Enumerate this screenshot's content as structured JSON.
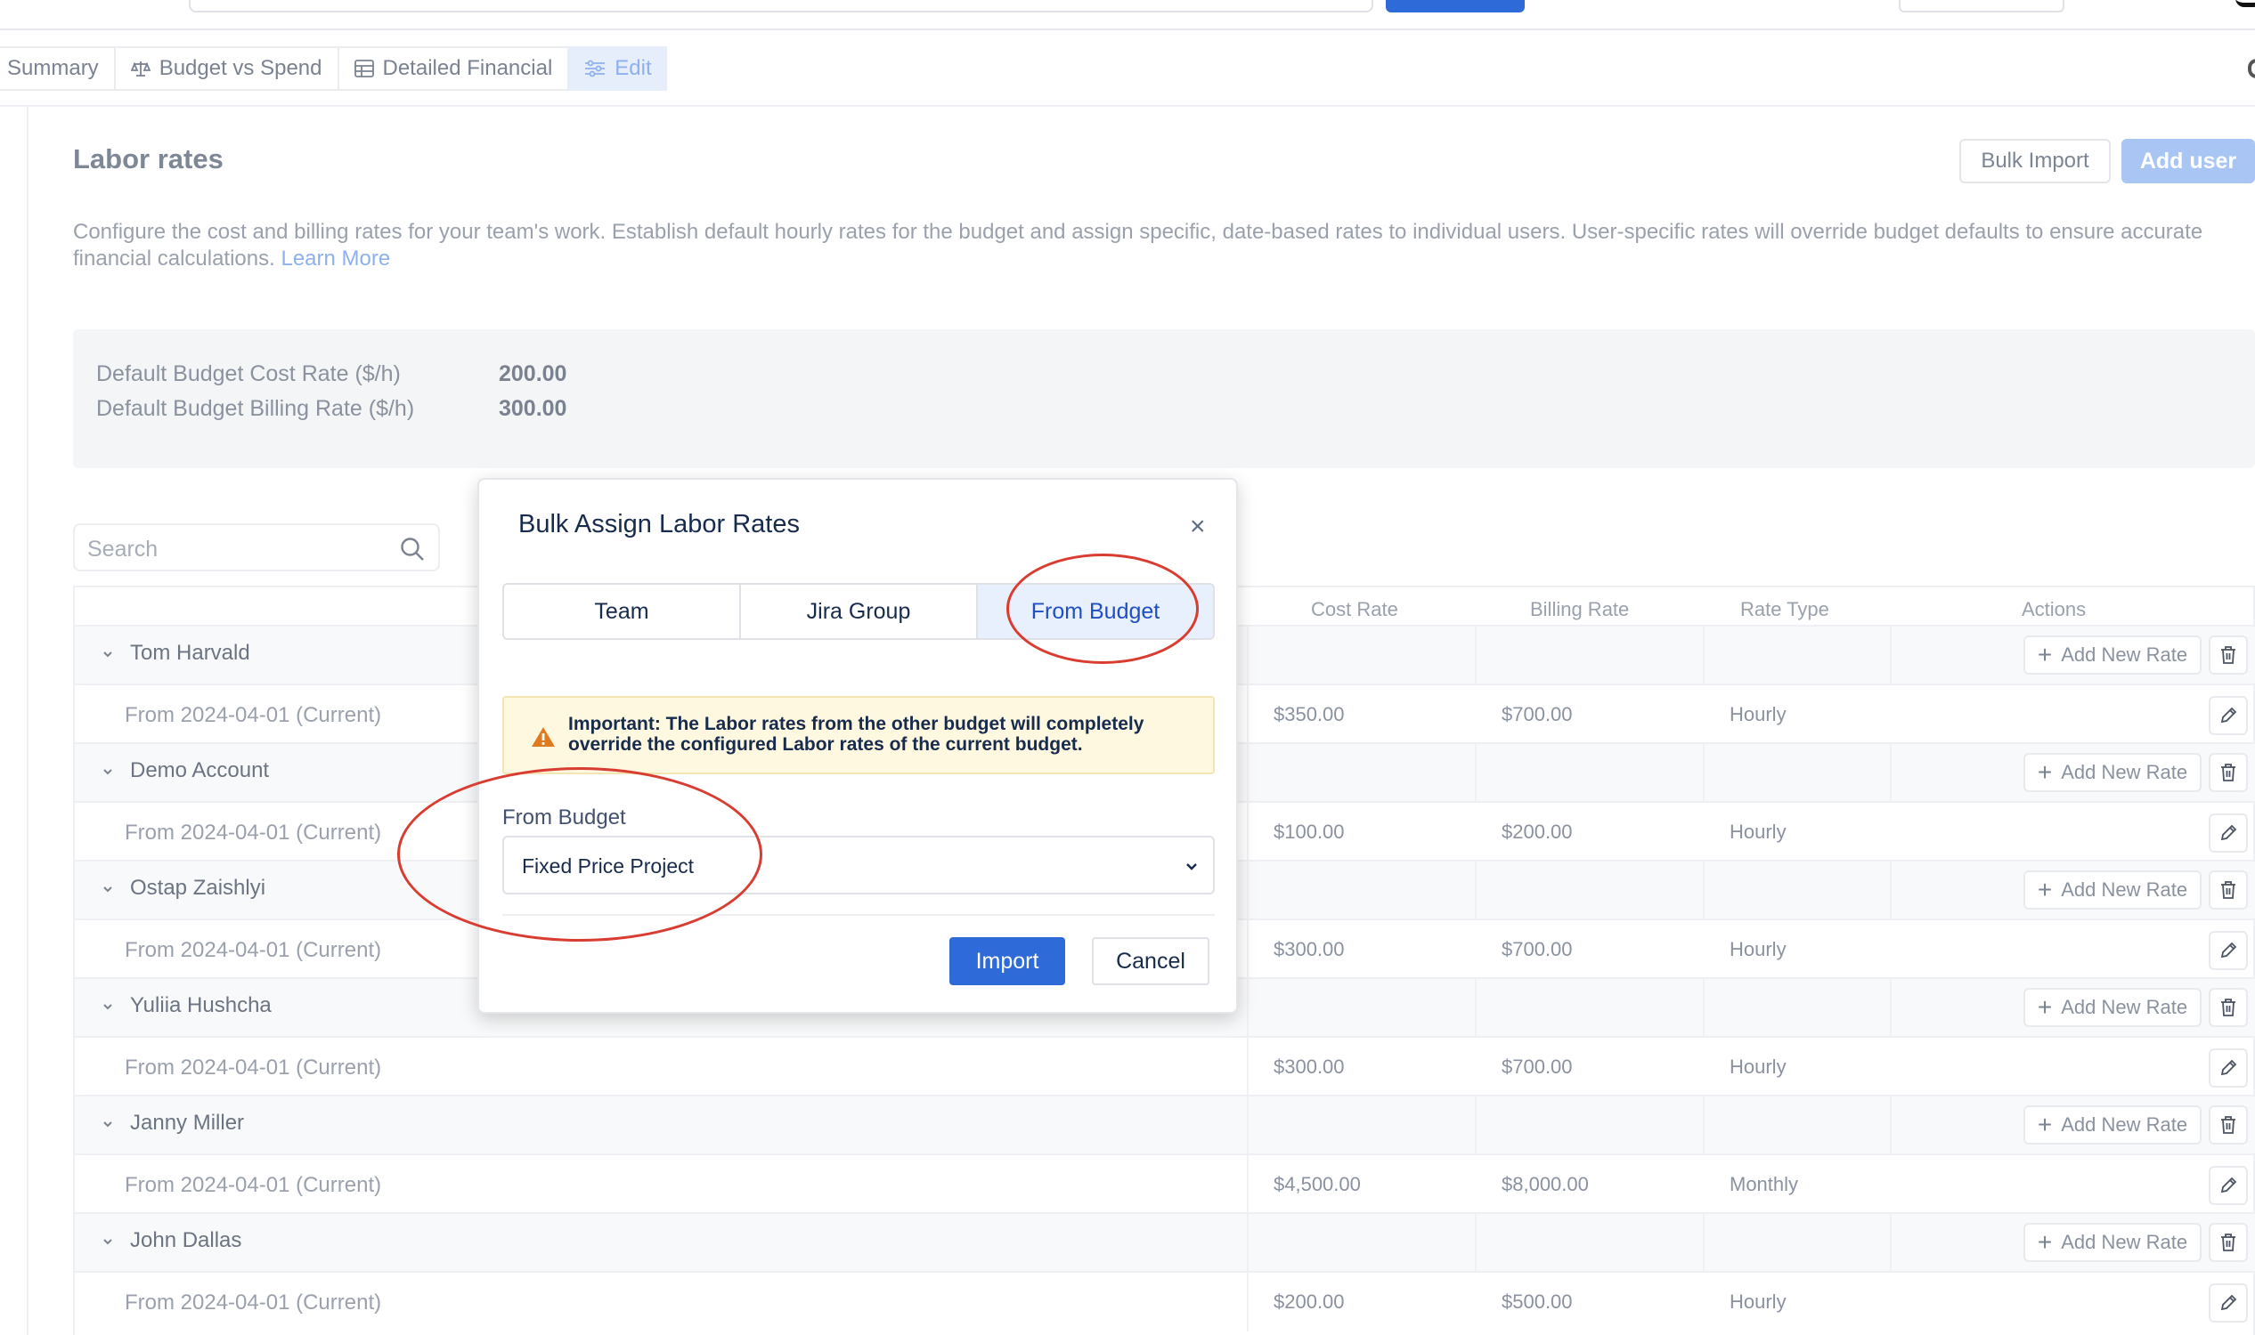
{
  "tabs": [
    {
      "label": "Summary",
      "icon": "none"
    },
    {
      "label": "Budget vs Spend",
      "icon": "scale-icon"
    },
    {
      "label": "Detailed Financial",
      "icon": "table-icon"
    },
    {
      "label": "Edit",
      "icon": "sliders-icon",
      "active": true
    }
  ],
  "page": {
    "title": "Labor rates",
    "bulk_import_label": "Bulk Import",
    "add_user_label": "Add user",
    "description": "Configure the cost and billing rates for your team's work. Establish default hourly rates for the budget and assign specific, date-based rates to individual users. User-specific rates will override budget defaults to ensure accurate financial calculations.",
    "learn_more": "Learn More"
  },
  "defaults": {
    "cost_label": "Default Budget Cost Rate ($/h)",
    "cost_value": "200.00",
    "billing_label": "Default Budget Billing Rate ($/h)",
    "billing_value": "300.00"
  },
  "search": {
    "placeholder": "Search"
  },
  "table": {
    "headers": {
      "cost_rate": "Cost Rate",
      "billing_rate": "Billing Rate",
      "rate_type": "Rate Type",
      "actions": "Actions"
    },
    "add_new_rate_label": "Add New Rate",
    "users": [
      {
        "name": "Tom Harvald",
        "rate_from": "From 2024-04-01 (Current)",
        "cost": "$350.00",
        "billing": "$700.00",
        "type": "Hourly"
      },
      {
        "name": "Demo Account",
        "rate_from": "From 2024-04-01 (Current)",
        "cost": "$100.00",
        "billing": "$200.00",
        "type": "Hourly"
      },
      {
        "name": "Ostap Zaishlyi",
        "rate_from": "From 2024-04-01 (Current)",
        "cost": "$300.00",
        "billing": "$700.00",
        "type": "Hourly"
      },
      {
        "name": "Yuliia Hushcha",
        "rate_from": "From 2024-04-01 (Current)",
        "cost": "$300.00",
        "billing": "$700.00",
        "type": "Hourly"
      },
      {
        "name": "Janny Miller",
        "rate_from": "From 2024-04-01 (Current)",
        "cost": "$4,500.00",
        "billing": "$8,000.00",
        "type": "Monthly"
      },
      {
        "name": "John Dallas",
        "rate_from": "From 2024-04-01 (Current)",
        "cost": "$200.00",
        "billing": "$500.00",
        "type": "Hourly"
      }
    ]
  },
  "modal": {
    "title": "Bulk Assign Labor Rates",
    "close": "×",
    "segments": [
      "Team",
      "Jira Group",
      "From Budget"
    ],
    "active_segment": "From Budget",
    "warning": "Important: The Labor rates from the other budget will completely override the configured Labor rates of the current budget.",
    "field_label": "From Budget",
    "selected_budget": "Fixed Price Project",
    "import_label": "Import",
    "cancel_label": "Cancel"
  },
  "colors": {
    "primary": "#2f6bd8",
    "annotation_red": "#d93c30",
    "warning_bg": "#fff8e1",
    "warning_icon": "#e07a1f"
  }
}
